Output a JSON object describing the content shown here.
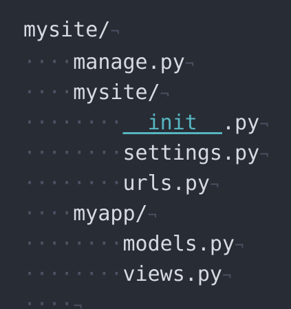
{
  "editor": {
    "whitespace_glyph": "·",
    "eol_glyph": "¬",
    "colors": {
      "background": "#282c34",
      "text": "#d7dae0",
      "invisibles": "#4b5263",
      "highlight": "#56b6c2"
    },
    "lines": [
      {
        "indent": 0,
        "text": "mysite/",
        "eol": "¬"
      },
      {
        "indent": 4,
        "text": "manage.py",
        "eol": "¬"
      },
      {
        "indent": 4,
        "text": "mysite/",
        "eol": "¬"
      },
      {
        "indent": 8,
        "text_highlight": "__init__",
        "text": ".py",
        "eol": "¬"
      },
      {
        "indent": 8,
        "text": "settings.py",
        "eol": "¬"
      },
      {
        "indent": 8,
        "text": "urls.py",
        "eol": "¬"
      },
      {
        "indent": 4,
        "text": "myapp/",
        "eol": "¬"
      },
      {
        "indent": 8,
        "text": "models.py",
        "eol": "¬"
      },
      {
        "indent": 8,
        "text": "views.py",
        "eol": "¬"
      },
      {
        "indent": 4,
        "text": "",
        "eol": "¬"
      }
    ]
  }
}
